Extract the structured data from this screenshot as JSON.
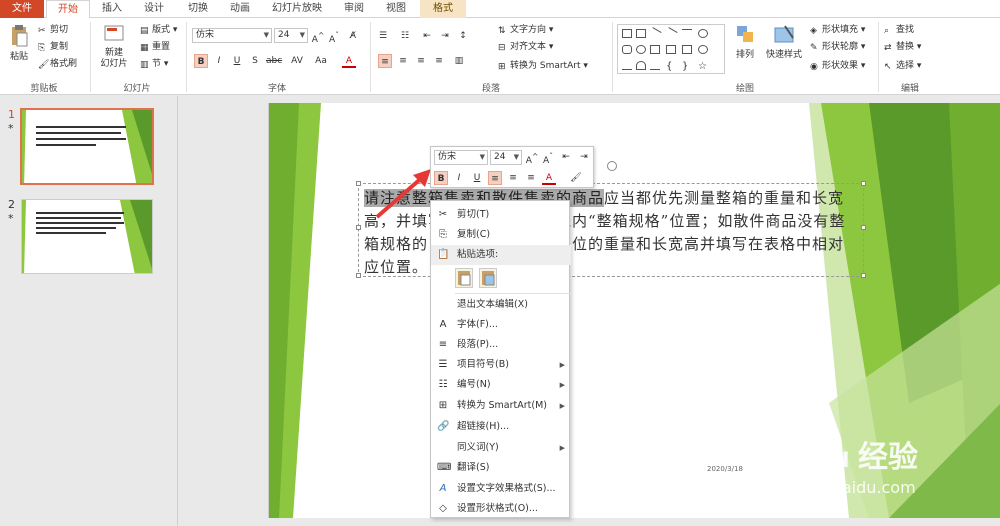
{
  "tabs": [
    "文件",
    "开始",
    "插入",
    "设计",
    "切换",
    "动画",
    "幻灯片放映",
    "审阅",
    "视图",
    "格式"
  ],
  "ribbon": {
    "clipboard": {
      "paste": "粘贴",
      "cut": "剪切",
      "copy": "复制",
      "painter": "格式刷",
      "label": "剪贴板"
    },
    "slides": {
      "new": "新建",
      "new2": "幻灯片",
      "layout": "版式",
      "reset": "重置",
      "section": "节",
      "label": "幻灯片"
    },
    "font": {
      "name": "仿宋",
      "size": "24",
      "label": "字体"
    },
    "paragraph": {
      "dir": "文字方向",
      "align": "对齐文本",
      "smartart": "转换为 SmartArt",
      "label": "段落"
    },
    "drawing": {
      "arrange": "排列",
      "quick": "快速样式",
      "fill": "形状填充",
      "outline": "形状轮廓",
      "effect": "形状效果",
      "label": "绘图"
    },
    "editing": {
      "find": "查找",
      "replace": "替换",
      "select": "选择",
      "label": "编辑"
    }
  },
  "slides_panel": [
    {
      "num": "1",
      "star": "*"
    },
    {
      "num": "2",
      "star": "*"
    }
  ],
  "slide": {
    "text_hl": "请注意整箱售卖和散件售卖的商品",
    "text_rest": "应当都优先测量整箱的重量和长宽高，并填写在表格中蓝色框线内“整箱规格”位置；如散件商品没有整箱规格的，则可以测量最小单位的重量和长宽高并填写在表格中相对应位置。",
    "date": "2020/3/18"
  },
  "mini_toolbar": {
    "font": "仿宋",
    "size": "24"
  },
  "context_menu": [
    {
      "icon": "✂",
      "label": "剪切(T)"
    },
    {
      "icon": "⎘",
      "label": "复制(C)"
    },
    {
      "icon": "📋",
      "label": "粘贴选项:"
    },
    {
      "icon": "",
      "label": "退出文本编辑(X)"
    },
    {
      "icon": "A",
      "label": "字体(F)..."
    },
    {
      "icon": "≡",
      "label": "段落(P)..."
    },
    {
      "icon": "☰",
      "label": "项目符号(B)"
    },
    {
      "icon": "☷",
      "label": "编号(N)"
    },
    {
      "icon": "⊞",
      "label": "转换为 SmartArt(M)"
    },
    {
      "icon": "🔗",
      "label": "超链接(H)..."
    },
    {
      "icon": "",
      "label": "同义词(Y)"
    },
    {
      "icon": "⌨",
      "label": "翻译(S)"
    },
    {
      "icon": "A",
      "label": "设置文字效果格式(S)..."
    },
    {
      "icon": "◇",
      "label": "设置形状格式(O)..."
    }
  ],
  "watermark": {
    "brand": "Bai du 经验",
    "url": "jingyan.baidu.com"
  },
  "colors": {
    "accent": "#d24726",
    "green": "#8dc63f",
    "dark_green": "#5a9a2a"
  }
}
